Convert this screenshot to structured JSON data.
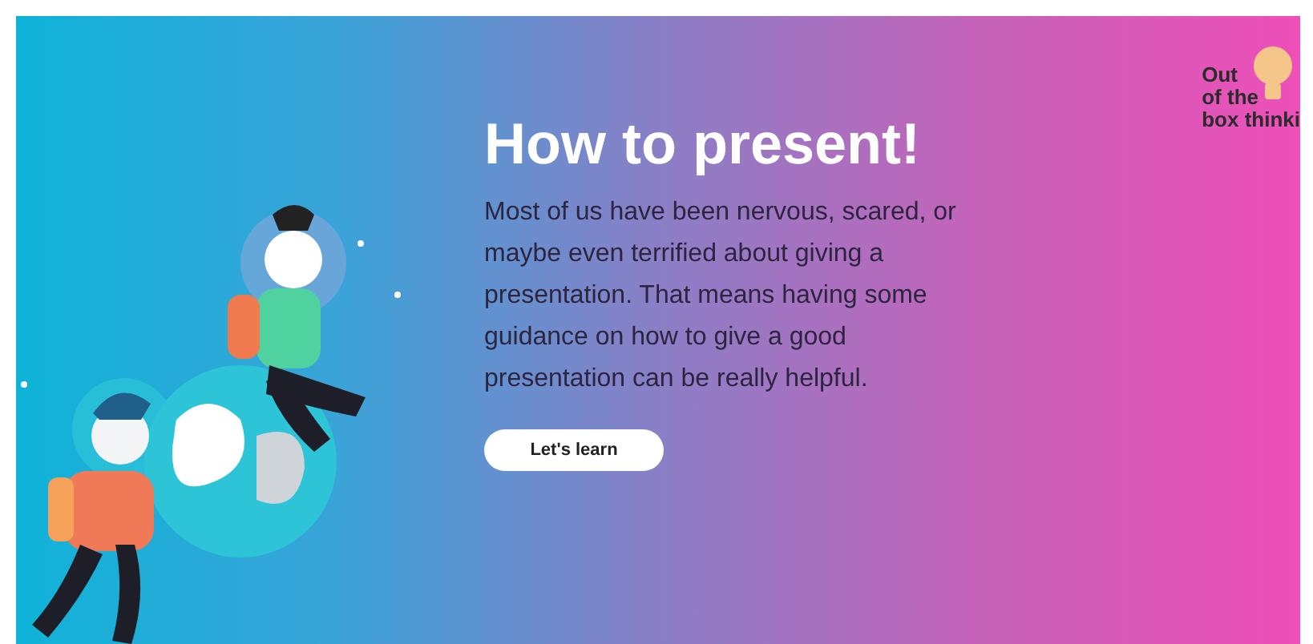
{
  "hero": {
    "title": "How to present!",
    "description": "Most of us have been nervous, scared, or maybe even terrified about giving a presentation. That means having some guidance on how to give a good presentation can be really helpful.",
    "button": "Let's learn"
  },
  "logo": {
    "lines": [
      "Out",
      "of the",
      "box thinki"
    ]
  }
}
